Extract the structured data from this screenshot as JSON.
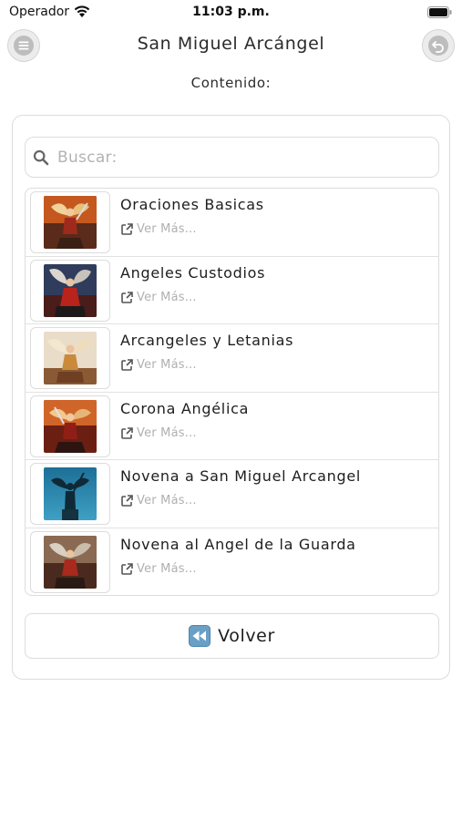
{
  "status_bar": {
    "carrier": "Operador",
    "time": "11:03 p.m."
  },
  "nav": {
    "title": "San Miguel Arcángel",
    "menu_icon": "hamburger-menu-icon",
    "back_icon": "undo-arrow-icon"
  },
  "section": {
    "label": "Contenido:"
  },
  "search": {
    "placeholder": "Buscar:",
    "value": ""
  },
  "items": [
    {
      "title": "Oraciones Basicas",
      "link": "Ver Más...",
      "thumb": "archangel-icon"
    },
    {
      "title": "Angeles Custodios",
      "link": "Ver Más...",
      "thumb": "archangel-icon"
    },
    {
      "title": "Arcangeles y Letanias",
      "link": "Ver Más...",
      "thumb": "archangel-icon"
    },
    {
      "title": "Corona Angélica",
      "link": "Ver Más...",
      "thumb": "archangel-icon"
    },
    {
      "title": "Novena a San Miguel Arcangel",
      "link": "Ver Más...",
      "thumb": "statue-icon"
    },
    {
      "title": "Novena al Angel de la Guarda",
      "link": "Ver Más...",
      "thumb": "archangel-icon"
    }
  ],
  "footer": {
    "volver_label": "Volver",
    "volver_icon": "rewind-icon"
  },
  "colors": {
    "border": "#dcdcdc",
    "placeholder": "#b3b3b3",
    "link_text": "#b0b0b0",
    "rewind_button": "#6a9fc6"
  }
}
